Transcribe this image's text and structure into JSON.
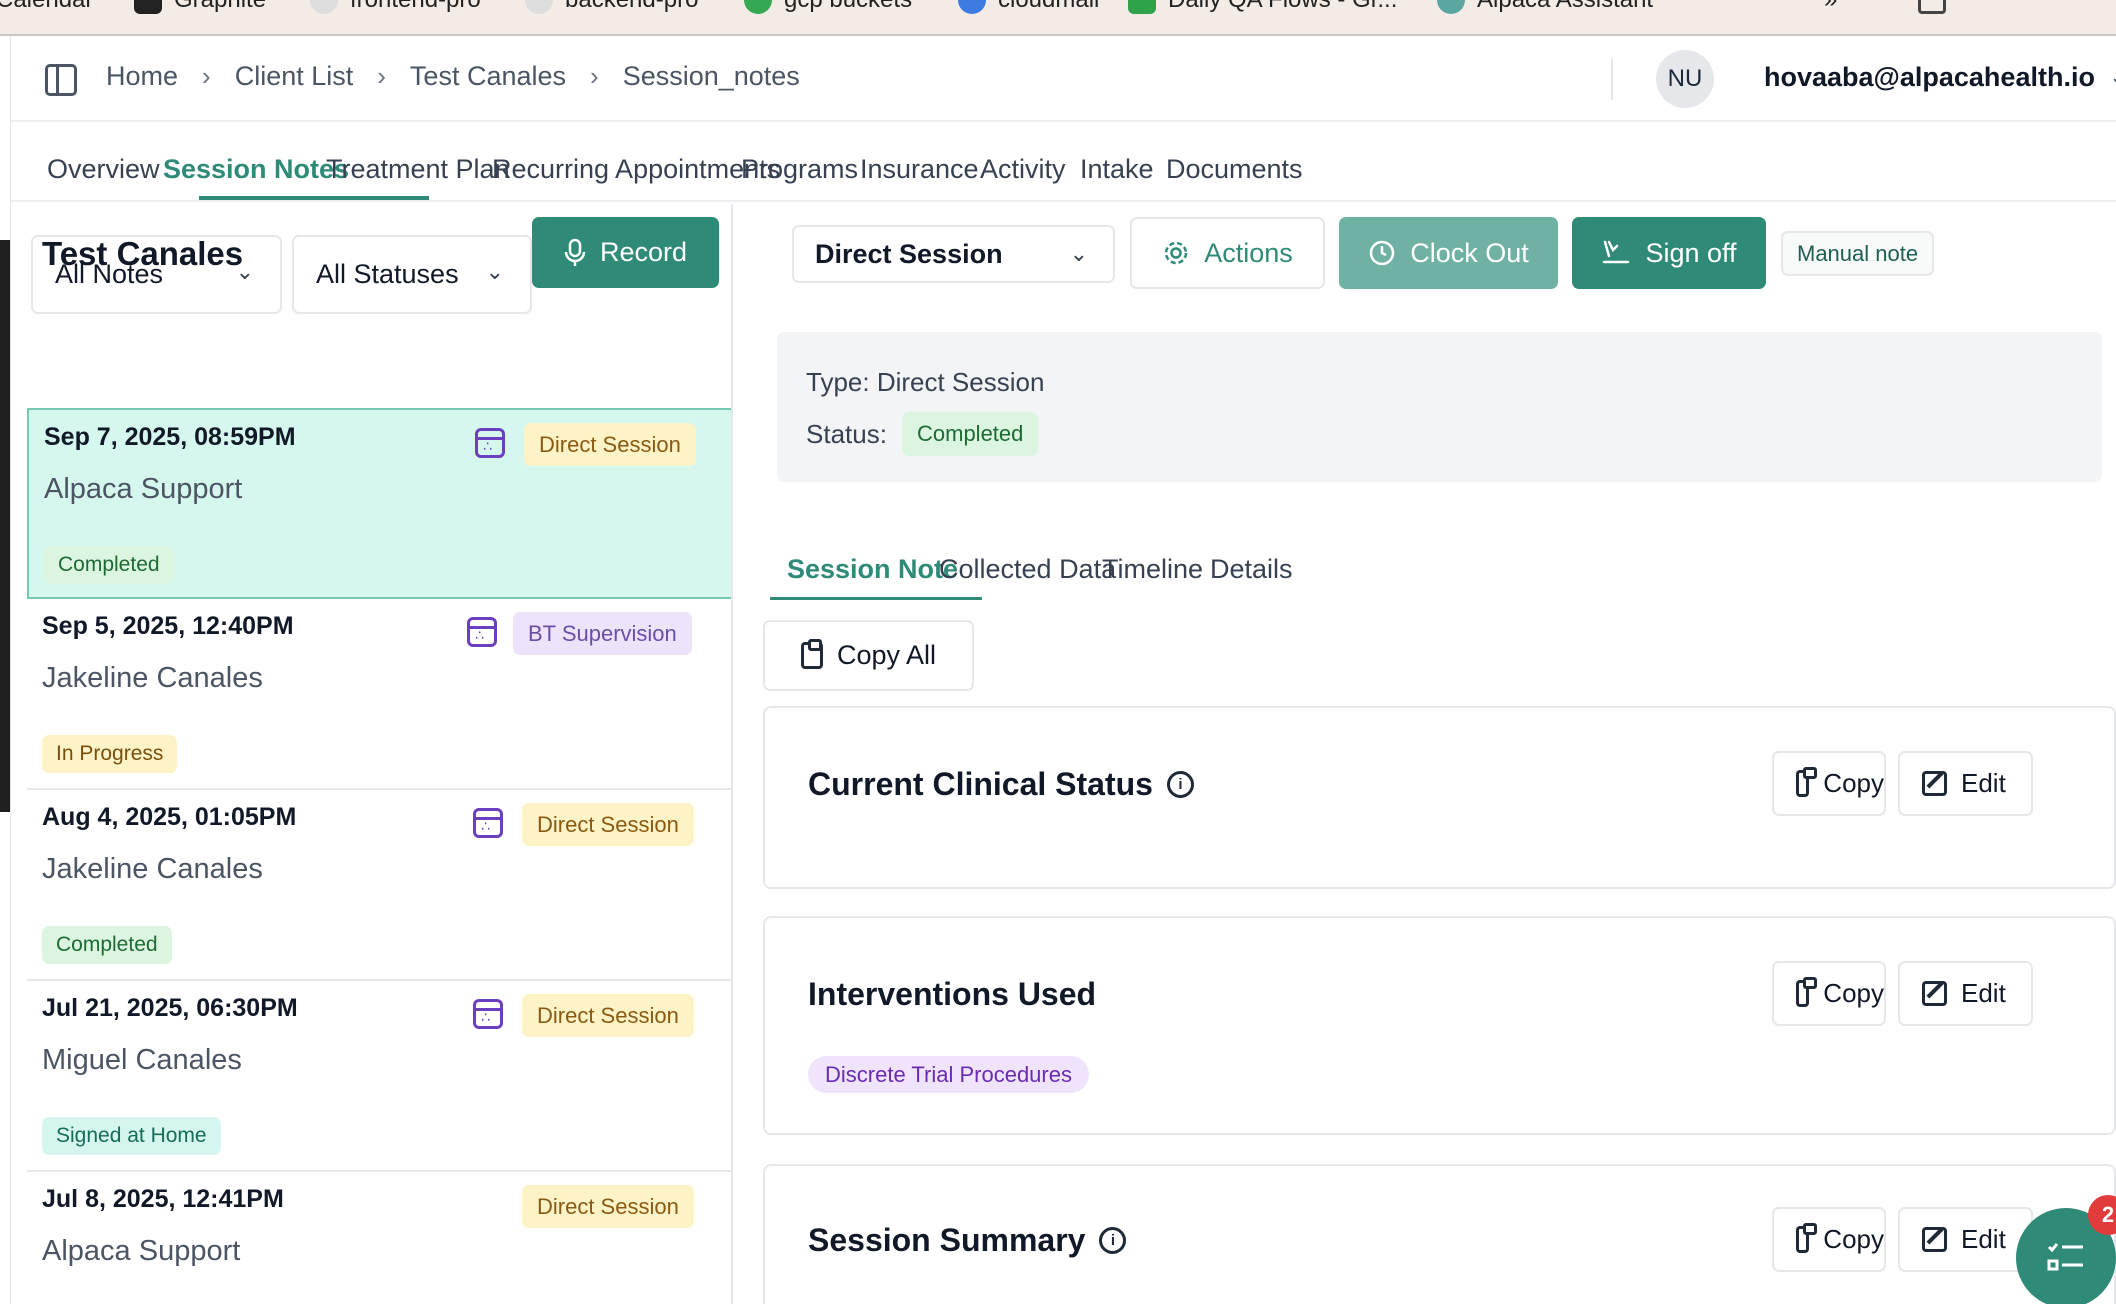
{
  "bookmarks": [
    {
      "label": "Calendar",
      "color": "#4a7fd6"
    },
    {
      "label": "Graphite",
      "color": "#222222"
    },
    {
      "label": "frontend-pro",
      "color": "#dddddd"
    },
    {
      "label": "backend-pro",
      "color": "#dddddd"
    },
    {
      "label": "gcp buckets",
      "color": "#34a853"
    },
    {
      "label": "cloudmail",
      "color": "#3d7be0"
    },
    {
      "label": "Daily QA Flows - Gr...",
      "color": "#2ea34a"
    },
    {
      "label": "Alpaca Assistant",
      "color": "#5aa6a0"
    }
  ],
  "header": {
    "breadcrumbs": [
      "Home",
      "Client List",
      "Test Canales",
      "Session_notes"
    ],
    "avatar_initials": "NU",
    "user_email": "hovaaba@alpacahealth.io"
  },
  "tabs": [
    {
      "label": "Overview",
      "active": false
    },
    {
      "label": "Session Notes",
      "active": true
    },
    {
      "label": "Treatment Plan",
      "active": false
    },
    {
      "label": "Recurring Appointments",
      "active": false
    },
    {
      "label": "Programs",
      "active": false
    },
    {
      "label": "Insurance",
      "active": false
    },
    {
      "label": "Activity",
      "active": false
    },
    {
      "label": "Intake",
      "active": false
    },
    {
      "label": "Documents",
      "active": false
    }
  ],
  "left_panel": {
    "client_name": "Test Canales",
    "record_label": "Record",
    "notes_filter": "All Notes",
    "status_filter": "All Statuses",
    "notes": [
      {
        "date": "Sep 7, 2025, 08:59PM",
        "client": "Alpaca Support",
        "type": "Direct Session",
        "status": "Completed",
        "selected": true,
        "has_calendar": true
      },
      {
        "date": "Sep 5, 2025, 12:40PM",
        "client": "Jakeline Canales",
        "type": "BT Supervision",
        "status": "In Progress",
        "selected": false,
        "has_calendar": true
      },
      {
        "date": "Aug 4, 2025, 01:05PM",
        "client": "Jakeline Canales",
        "type": "Direct Session",
        "status": "Completed",
        "selected": false,
        "has_calendar": true
      },
      {
        "date": "Jul 21, 2025, 06:30PM",
        "client": "Miguel Canales",
        "type": "Direct Session",
        "status": "Signed at Home",
        "selected": false,
        "has_calendar": true
      },
      {
        "date": "Jul 8, 2025, 12:41PM",
        "client": "Alpaca Support",
        "type": "Direct Session",
        "status": "",
        "selected": false,
        "has_calendar": false
      }
    ]
  },
  "right_panel": {
    "session_type_select": "Direct Session",
    "actions_label": "Actions",
    "clock_out_label": "Clock Out",
    "sign_off_label": "Sign off",
    "manual_note_label": "Manual note",
    "info": {
      "type_text": "Type: Direct Session",
      "status_label": "Status:",
      "status_value": "Completed"
    },
    "sub_tabs": [
      "Session Note",
      "Collected Data",
      "Timeline",
      "Details"
    ],
    "copy_all_label": "Copy All",
    "sections": [
      {
        "title": "Current Clinical Status",
        "copy_label": "Copy",
        "edit_label": "Edit",
        "tag": ""
      },
      {
        "title": "Interventions Used",
        "copy_label": "Copy",
        "edit_label": "Edit",
        "tag": "Discrete Trial Procedures"
      },
      {
        "title": "Session Summary",
        "copy_label": "Copy",
        "edit_label": "Edit",
        "tag": ""
      }
    ]
  },
  "fab": {
    "badge_count": "2"
  },
  "colors": {
    "accent": "#2f8a78",
    "selected_row": "#d6f7ee",
    "clock_out_bg": "#6fb2a4"
  }
}
